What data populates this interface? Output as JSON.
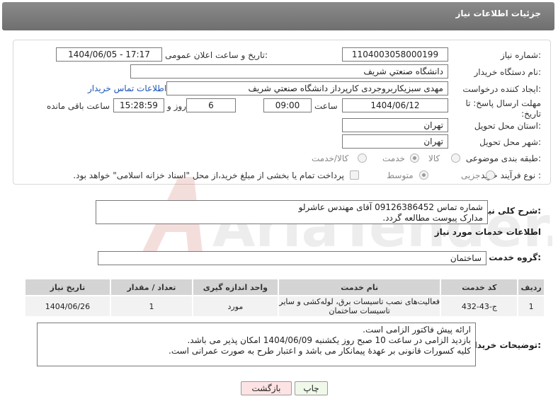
{
  "header": {
    "title": "جزئیات اطلاعات نیاز"
  },
  "form": {
    "need_number": {
      "label": "شماره نیاز:",
      "value": "1104003058000199"
    },
    "announce_datetime": {
      "label": "تاریخ و ساعت اعلان عمومی:",
      "value": "1404/06/05 - 17:17"
    },
    "buyer_org": {
      "label": "نام دستگاه خریدار:",
      "value": "دانشگاه صنعتي شريف"
    },
    "requester": {
      "label": "ایجاد کننده درخواست:",
      "value": "مهدی سبزیکاربروجردی کارپرداز دانشگاه صنعتي شريف",
      "contact_link": "اطلاعات تماس خریدار"
    },
    "deadline": {
      "label": "مهلت ارسال پاسخ: تا تاریخ:",
      "date": "1404/06/12",
      "time_label": "ساعت",
      "time": "09:00",
      "days": "6",
      "days_label": "روز و",
      "remaining_time": "15:28:59",
      "remaining_label": "ساعت باقی مانده"
    },
    "delivery_province": {
      "label": "استان محل تحویل:",
      "value": "تهران"
    },
    "delivery_city": {
      "label": "شهر محل تحویل:",
      "value": "تهران"
    },
    "category": {
      "label": "طبقه بندی موضوعی:",
      "options": [
        "کالا",
        "خدمت",
        "کالا/خدمت"
      ],
      "selected": "خدمت"
    },
    "purchase_type": {
      "label": "نوع فرآیند خرید :",
      "options": [
        "جزیی",
        "متوسط"
      ],
      "selected": "متوسط",
      "payment_note": "پرداخت تمام یا بخشی از مبلغ خرید،از محل \"اسناد خزانه اسلامی\" خواهد بود."
    }
  },
  "summary": {
    "label": "شرح کلی نیاز:",
    "lines": [
      "شماره تماس 09126386452 آقای مهندس عاشرلو",
      "مدارک پیوست مطالعه گردد."
    ]
  },
  "services_section": {
    "title": "اطلاعات خدمات مورد نیاز",
    "group_label": "گروه خدمت:",
    "group_value": "ساختمان"
  },
  "table": {
    "headers": [
      "ردیف",
      "کد خدمت",
      "نام خدمت",
      "واحد اندازه گیری",
      "تعداد / مقدار",
      "تاریخ نیاز"
    ],
    "rows": [
      [
        "1",
        "ج-43-432",
        "فعالیت‌های نصب تاسیسات برق، لوله‌کشی و سایر تاسیسات ساختمان",
        "مورد",
        "1",
        "1404/06/26"
      ]
    ]
  },
  "buyer_notes": {
    "label": "توضیحات خریدار:",
    "lines": [
      "ارائه پیش فاکتور الزامی است.",
      "بازدید الزامی در ساعت 10 صبح روز یکشنبه 1404/06/09 امکان پذیر می باشد.",
      "کلیه کسورات قانونی بر عهدهٔ پیمانکار می باشد و اعتبار طرح به صورت عمرانی است."
    ]
  },
  "buttons": {
    "print": "چاپ",
    "back": "بازگشت"
  },
  "watermark": {
    "text": "AriaTender.net"
  },
  "colors": {
    "header_bg": "#7a7a7a",
    "link": "#1a55b8",
    "watermark": "#c0392b",
    "back_button_bg": "#fde3e3"
  }
}
